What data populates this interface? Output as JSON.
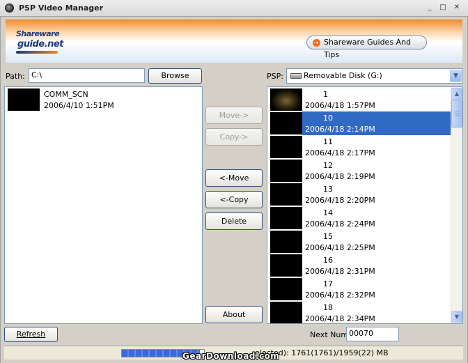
{
  "window": {
    "title": "PSP Video Manager",
    "min_glyph": "_",
    "max_glyph": "□",
    "close_glyph": "✕"
  },
  "banner": {
    "logo_line1": "Shareware",
    "logo_line2": "guide.net",
    "tips_button": "Shareware Guides And Tips"
  },
  "path": {
    "label": "Path:",
    "value": "C:\\",
    "browse_label": "Browse"
  },
  "psp": {
    "label": "PSP:",
    "selected": "Removable Disk (G:)"
  },
  "left_list": {
    "items": [
      {
        "name": "COMM_SCN",
        "date": "2006/4/10 1:51PM"
      }
    ]
  },
  "right_list": {
    "items": [
      {
        "name": "1",
        "date": "2006/4/18 1:57PM"
      },
      {
        "name": "10",
        "date": "2006/4/18 2:14PM",
        "selected": true
      },
      {
        "name": "11",
        "date": "2006/4/18 2:17PM"
      },
      {
        "name": "12",
        "date": "2006/4/18 2:19PM"
      },
      {
        "name": "13",
        "date": "2006/4/18 2:20PM"
      },
      {
        "name": "14",
        "date": "2006/4/18 2:24PM"
      },
      {
        "name": "15",
        "date": "2006/4/18 2:25PM"
      },
      {
        "name": "16",
        "date": "2006/4/18 2:31PM"
      },
      {
        "name": "17",
        "date": "2006/4/18 2:32PM"
      },
      {
        "name": "18",
        "date": "2006/4/18 2:34PM"
      }
    ]
  },
  "actions": {
    "move_right": "Move->",
    "copy_right": "Copy->",
    "move_left": "<-Move",
    "copy_left": "<-Copy",
    "delete": "Delete",
    "about": "About"
  },
  "bottom": {
    "refresh_label": "Refresh",
    "next_num_label": "Next Num",
    "next_num_value": "00070"
  },
  "status": {
    "text": "elected):  1761(1761)/1959(22) MB",
    "progress": 0.95,
    "watermark": "GearDownload.com"
  },
  "colors": {
    "selection": "#316ac5",
    "banner_orange": "#f08a2a"
  }
}
